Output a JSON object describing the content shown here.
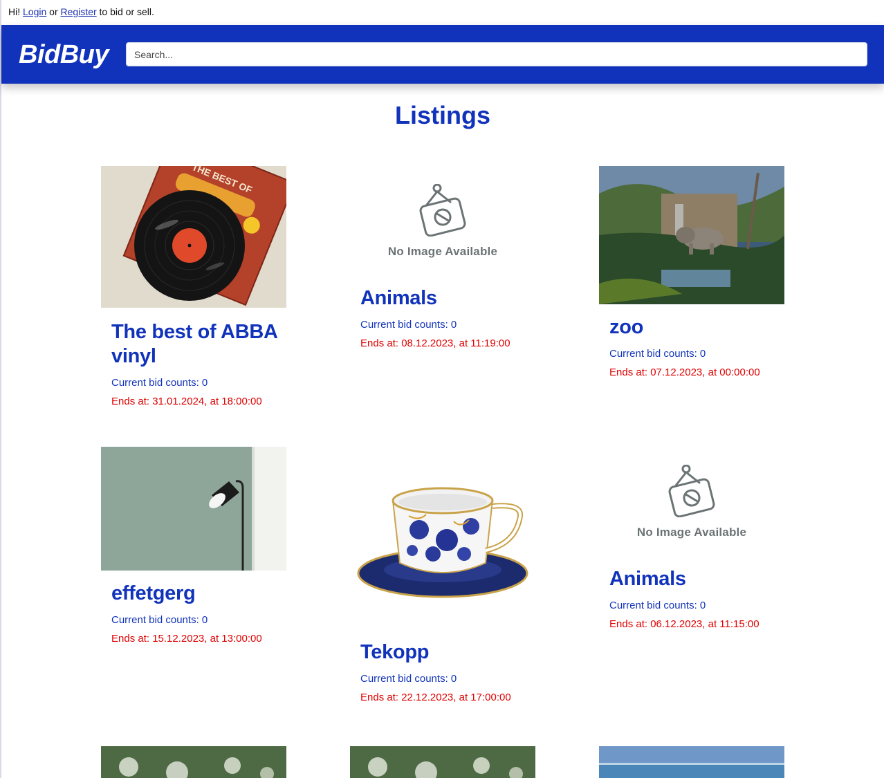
{
  "topbar": {
    "greeting": "Hi!",
    "login": "Login",
    "or": "or",
    "register": "Register",
    "suffix": "to bid or sell."
  },
  "header": {
    "logo": "BidBuy",
    "search_placeholder": "Search..."
  },
  "page": {
    "title": "Listings"
  },
  "no_image_text": "No Image Available",
  "listings": [
    {
      "title": "The best of ABBA vinyl",
      "bids": "Current bid counts: 0",
      "ends": "Ends at: 31.01.2024, at 18:00:00"
    },
    {
      "title": "Animals",
      "bids": "Current bid counts: 0",
      "ends": "Ends at: 08.12.2023, at 11:19:00"
    },
    {
      "title": "zoo",
      "bids": "Current bid counts: 0",
      "ends": "Ends at: 07.12.2023, at 00:00:00"
    },
    {
      "title": "effetgerg",
      "bids": "Current bid counts: 0",
      "ends": "Ends at: 15.12.2023, at 13:00:00"
    },
    {
      "title": "Tekopp",
      "bids": "Current bid counts: 0",
      "ends": "Ends at: 22.12.2023, at 17:00:00"
    },
    {
      "title": "Animals",
      "bids": "Current bid counts: 0",
      "ends": "Ends at: 06.12.2023, at 11:15:00"
    }
  ],
  "colors": {
    "brand": "#1133bb",
    "end_date": "#e00000"
  }
}
